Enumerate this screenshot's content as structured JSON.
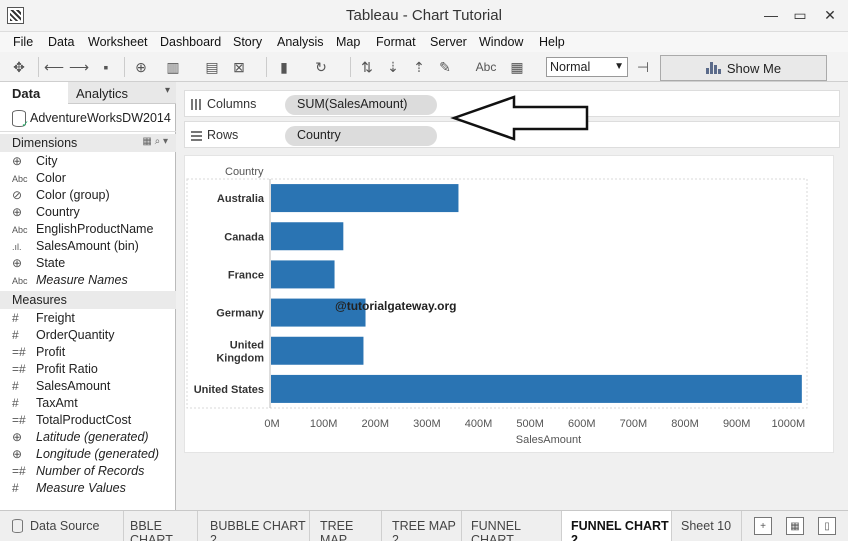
{
  "window": {
    "title": "Tableau - Chart Tutorial"
  },
  "menu": [
    "File",
    "Data",
    "Worksheet",
    "Dashboard",
    "Story",
    "Analysis",
    "Map",
    "Format",
    "Server",
    "Window",
    "Help"
  ],
  "toolbar": {
    "fit_value": "Normal",
    "text_label_button": "Abc",
    "show_me": "Show Me"
  },
  "side_panel": {
    "tabs": {
      "data": "Data",
      "analytics": "Analytics"
    },
    "data_source": "AdventureWorksDW2014",
    "dimensions_header": "Dimensions",
    "dimensions": [
      {
        "icon": "globe-icon",
        "name": "City",
        "italic": false
      },
      {
        "icon": "abc-icon",
        "name": "Color",
        "italic": false
      },
      {
        "icon": "paperclip-icon",
        "name": "Color (group)",
        "italic": false
      },
      {
        "icon": "globe-icon",
        "name": "Country",
        "italic": false
      },
      {
        "icon": "abc-icon",
        "name": "EnglishProductName",
        "italic": false
      },
      {
        "icon": "bin-icon",
        "name": "SalesAmount (bin)",
        "italic": false
      },
      {
        "icon": "globe-icon",
        "name": "State",
        "italic": false
      },
      {
        "icon": "abc-icon",
        "name": "Measure Names",
        "italic": true
      }
    ],
    "measures_header": "Measures",
    "measures": [
      {
        "icon": "hash-icon",
        "name": "Freight",
        "italic": false
      },
      {
        "icon": "hash-icon",
        "name": "OrderQuantity",
        "italic": false
      },
      {
        "icon": "calc-hash-icon",
        "name": "Profit",
        "italic": false
      },
      {
        "icon": "calc-hash-icon",
        "name": "Profit Ratio",
        "italic": false
      },
      {
        "icon": "hash-icon",
        "name": "SalesAmount",
        "italic": false
      },
      {
        "icon": "hash-icon",
        "name": "TaxAmt",
        "italic": false
      },
      {
        "icon": "calc-hash-icon",
        "name": "TotalProductCost",
        "italic": false
      },
      {
        "icon": "globe-icon",
        "name": "Latitude (generated)",
        "italic": true
      },
      {
        "icon": "globe-icon",
        "name": "Longitude (generated)",
        "italic": true
      },
      {
        "icon": "calc-hash-icon",
        "name": "Number of Records",
        "italic": true
      },
      {
        "icon": "hash-icon",
        "name": "Measure Values",
        "italic": true
      }
    ]
  },
  "shelves": {
    "columns": {
      "label": "Columns",
      "pill": "SUM(SalesAmount)"
    },
    "rows": {
      "label": "Rows",
      "pill": "Country"
    }
  },
  "watermark": "@tutorialgateway.org",
  "chart_data": {
    "type": "bar",
    "orientation": "horizontal",
    "categories": [
      "Australia",
      "Canada",
      "France",
      "Germany",
      "United Kingdom",
      "United States"
    ],
    "category_labels": [
      [
        "Australia"
      ],
      [
        "Canada"
      ],
      [
        "France"
      ],
      [
        "Germany"
      ],
      [
        "United",
        "Kingdom"
      ],
      [
        "United States"
      ]
    ],
    "values": [
      365,
      142,
      125,
      185,
      181,
      1030
    ],
    "units": "M",
    "xlim": [
      0,
      1040
    ],
    "xticks": [
      "0M",
      "100M",
      "200M",
      "300M",
      "400M",
      "500M",
      "600M",
      "700M",
      "800M",
      "900M",
      "1000M"
    ],
    "xlabel": "SalesAmount",
    "ylabel": "Country",
    "bar_color": "#2a74b3"
  },
  "sheet_tabs": {
    "data_source": "Data Source",
    "tabs": [
      "BBLE CHART",
      "BUBBLE CHART 2",
      "TREE MAP",
      "TREE MAP 2",
      "FUNNEL CHART",
      "FUNNEL CHART 2",
      "Sheet 10"
    ],
    "active": "FUNNEL CHART 2"
  }
}
